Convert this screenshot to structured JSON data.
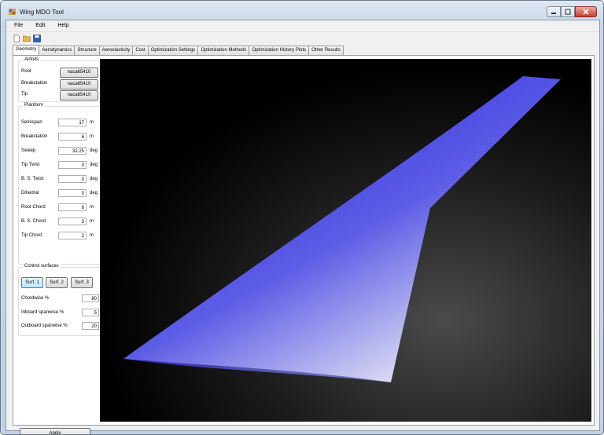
{
  "window": {
    "title": "Wing MDO Tool"
  },
  "menu": [
    "File",
    "Edit",
    "Help"
  ],
  "toolbar": {
    "icons": [
      "new-document-icon",
      "open-folder-icon",
      "save-disk-icon"
    ]
  },
  "tabs": [
    "Geometry",
    "Aerodynamics",
    "Structure",
    "Aeroelasticity",
    "Cost",
    "Optimization Settings",
    "Optimization Methods",
    "Optimization History Plots",
    "Other Results"
  ],
  "airfoils": {
    "title": "Airfoils",
    "rows": [
      {
        "label": "Root",
        "value": "naca65410"
      },
      {
        "label": "Breakstation",
        "value": "naca65410"
      },
      {
        "label": "Tip",
        "value": "naca65410"
      }
    ]
  },
  "planform": {
    "title": "Planform",
    "rows": [
      {
        "label": "Semispan",
        "value": "17",
        "unit": "m"
      },
      {
        "label": "Breakstation",
        "value": "6",
        "unit": "m"
      },
      {
        "label": "Sweep",
        "value": "32.25",
        "unit": "deg"
      },
      {
        "label": "Tip Twist",
        "value": "0",
        "unit": "deg"
      },
      {
        "label": "B. S. Twist",
        "value": "0",
        "unit": "deg"
      },
      {
        "label": "Dihedral",
        "value": "0",
        "unit": "deg"
      },
      {
        "label": "Root Chord",
        "value": "6",
        "unit": "m"
      },
      {
        "label": "B. S. Chord",
        "value": "3",
        "unit": "m"
      },
      {
        "label": "Tip Chord",
        "value": "2",
        "unit": "m"
      }
    ]
  },
  "control_surfaces": {
    "title": "Control surfaces",
    "buttons": [
      "Surf. 1",
      "Surf. 2",
      "Surf. 3"
    ],
    "rows": [
      {
        "label": "Chordwise %",
        "value": "80"
      },
      {
        "label": "Inboard spanwise %",
        "value": "5"
      },
      {
        "label": "Outboard spanwise %",
        "value": "20"
      }
    ]
  },
  "apply_label": "Apply",
  "colors": {
    "wing": "#3f3fe0",
    "viewport_bg": "#000000",
    "accent": "#3c7fb1"
  }
}
